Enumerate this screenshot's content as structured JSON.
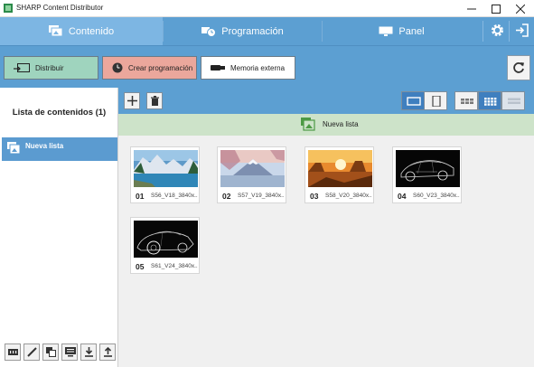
{
  "window": {
    "title": "SHARP Content Distributor"
  },
  "nav": {
    "tabs": [
      {
        "label": "Contenido",
        "active": true
      },
      {
        "label": "Programación",
        "active": false
      },
      {
        "label": "Panel",
        "active": false
      }
    ]
  },
  "actions": {
    "distribute": "Distribuir",
    "create_schedule": "Crear programación",
    "external_memory": "Memoria externa"
  },
  "sidebar": {
    "header": "Lista de contenidos (1)",
    "lists": [
      {
        "label": "Nueva lista",
        "selected": true
      }
    ]
  },
  "content": {
    "list_name": "Nueva lista",
    "items": [
      {
        "num": "01",
        "file": "S56_V18_3840x...",
        "scene": "mountain-lake"
      },
      {
        "num": "02",
        "file": "S57_V19_3840x...",
        "scene": "mount-fuji"
      },
      {
        "num": "03",
        "file": "S58_V20_3840x...",
        "scene": "desert-sunset"
      },
      {
        "num": "04",
        "file": "S60_V23_3840x...",
        "scene": "car-wireframe-front"
      },
      {
        "num": "05",
        "file": "S61_V24_3840x...",
        "scene": "car-wireframe-side"
      }
    ]
  },
  "colors": {
    "nav_blue": "#5c9fd2",
    "tab_active": "#7db6e3",
    "selected_row": "#5b9bd0",
    "banner_green": "#cde3c9",
    "distribute_green": "#9fd4be",
    "schedule_red": "#eba79c"
  }
}
